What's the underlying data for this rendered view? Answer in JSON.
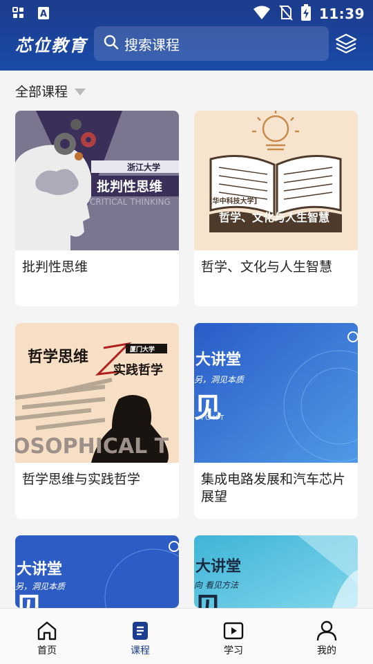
{
  "status_bar": {
    "time": "11:39",
    "icons": [
      "grid-icon",
      "text-a-icon",
      "wifi-icon",
      "no-sim-icon",
      "battery-charging-icon"
    ]
  },
  "app_bar": {
    "logo": "芯位教育",
    "search_placeholder": "搜索课程",
    "layers_icon": "layers-icon"
  },
  "filter": {
    "label": "全部课程",
    "caret_icon": "caret-down-icon"
  },
  "courses": [
    {
      "title": "批判性思维",
      "cover_school": "浙江大学",
      "cover_title": "批判性思维",
      "cover_sub": "CRITICAL THINKING"
    },
    {
      "title": "哲学、文化与人生智慧",
      "cover_school": "[华中科技大学]",
      "cover_title": "哲学、文化与人生智慧"
    },
    {
      "title": "哲学思维与实践哲学",
      "cover_school": "厦门大学",
      "cover_title": "哲学思维",
      "cover_title2": "实践哲学",
      "cover_sub": "OSOPHICAL T"
    },
    {
      "title": "集成电路发展和汽车芯片展望",
      "cover_brand": "大讲堂",
      "cover_slogan": "另，洞见本质",
      "cover_big": "见",
      "cover_sub": "IGHT"
    },
    {
      "title": "",
      "cover_brand": "大讲堂",
      "cover_slogan": "另，洞见本质",
      "cover_big": "见"
    },
    {
      "title": "",
      "cover_brand": "大讲堂",
      "cover_slogan": "向 看见方法",
      "cover_big": "见"
    }
  ],
  "bottom_nav": [
    {
      "label": "首页",
      "icon": "home-icon",
      "active": false
    },
    {
      "label": "课程",
      "icon": "course-book-icon",
      "active": true
    },
    {
      "label": "学习",
      "icon": "play-video-icon",
      "active": false
    },
    {
      "label": "我的",
      "icon": "profile-icon",
      "active": false
    }
  ],
  "colors": {
    "header": "#1c3c8c",
    "accent": "#1c3d8f",
    "background": "#f4f4f5"
  }
}
